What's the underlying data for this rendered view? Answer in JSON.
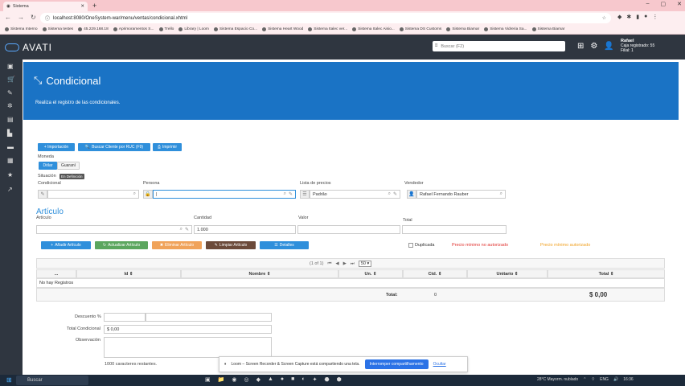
{
  "browser": {
    "tab_title": "Sistema",
    "url": "localhost:8080/OneSystem-war/menu/ventas/condicional.xhtml",
    "bookmarks": [
      "Sistema Interno",
      "Sistema testes",
      "45.229.168.18",
      "Aprimoramentos S...",
      "Trello",
      "Library | Loom",
      "Sistema Espacio Co...",
      "Sistema Heart Wood",
      "Sistema Italec ver...",
      "Sistema Italec Aisio...",
      "Sistema DS Customs",
      "Sistema Biamar",
      "Sistema Vidreria Sa...",
      "Sistema Biamar"
    ]
  },
  "app": {
    "brand": "AVATI",
    "search_placeholder": "Buscar (F2)",
    "user_name": "Rafael",
    "user_line2": "Caja registrado: 55",
    "user_line3": "Filial: 1"
  },
  "page": {
    "title": "Condicional",
    "description": "Realiza el registro de las condicionales."
  },
  "toolbar": {
    "new_label": "+ Importación",
    "search_client_label": "Buscar Cliente por RUC (F9)",
    "print_label": "Imprimir"
  },
  "form": {
    "moneda_label": "Moneda",
    "currency_options": [
      "Dólar",
      "Guaraní"
    ],
    "situacion_label": "Situación",
    "situacion_value": "En Definición",
    "condicional_label": "Condicional",
    "persona_label": "Persona",
    "persona_value": "|",
    "lista_label": "Lista de precios",
    "lista_value": "Padrão",
    "vendedor_label": "Vendedor",
    "vendedor_value": "Rafael Fernando Rauber"
  },
  "articulo": {
    "section_title": "Artículo",
    "articulo_label": "Artículo",
    "cantidad_label": "Cantidad",
    "cantidad_value": "1.000",
    "valor_label": "Valor",
    "total_label": "Total",
    "btn_add": "Añadir Artículo",
    "btn_update": "Actualizar Artículo",
    "btn_delete": "Eliminar Artículo",
    "btn_clear": "Limpiar Artículo",
    "btn_detail": "Detalles",
    "duplicada_label": "Duplicada",
    "warn_not_authorized": "Precio mínimo no autorizado",
    "warn_authorized": "Precio mínimo autorizado"
  },
  "table": {
    "paginator": "(1 of 1)",
    "page_size": "50",
    "columns": [
      "...",
      "Id",
      "Nombre",
      "Un.",
      "Ctd.",
      "Unitario",
      "Total"
    ],
    "empty_message": "No hay Registros",
    "total_label": "Total:",
    "total_qty": "0",
    "total_value": "$ 0,00"
  },
  "footer": {
    "descuento_label": "Descuento %",
    "total_condicional_label": "Total Condicional",
    "total_condicional_value": "$ 0,00",
    "observacion_label": "Observación",
    "chars_remaining": "1000 caracteres restantes."
  },
  "loom": {
    "message": "Loom – Screen Recorder & Screen Capture está compartiendo una tela.",
    "stop_label": "Interromper compartilhamento",
    "hide_label": "Ocultar"
  },
  "taskbar": {
    "search_label": "Buscar",
    "weather": "28°C Mayorm. nublado",
    "lang": "ENG",
    "time": "16:36"
  },
  "colors": {
    "banner": "#1a73c5",
    "header": "#2f3640",
    "primary_button": "#2f8fdb",
    "warn_red": "#e0322f",
    "warn_orange": "#f0a020"
  }
}
